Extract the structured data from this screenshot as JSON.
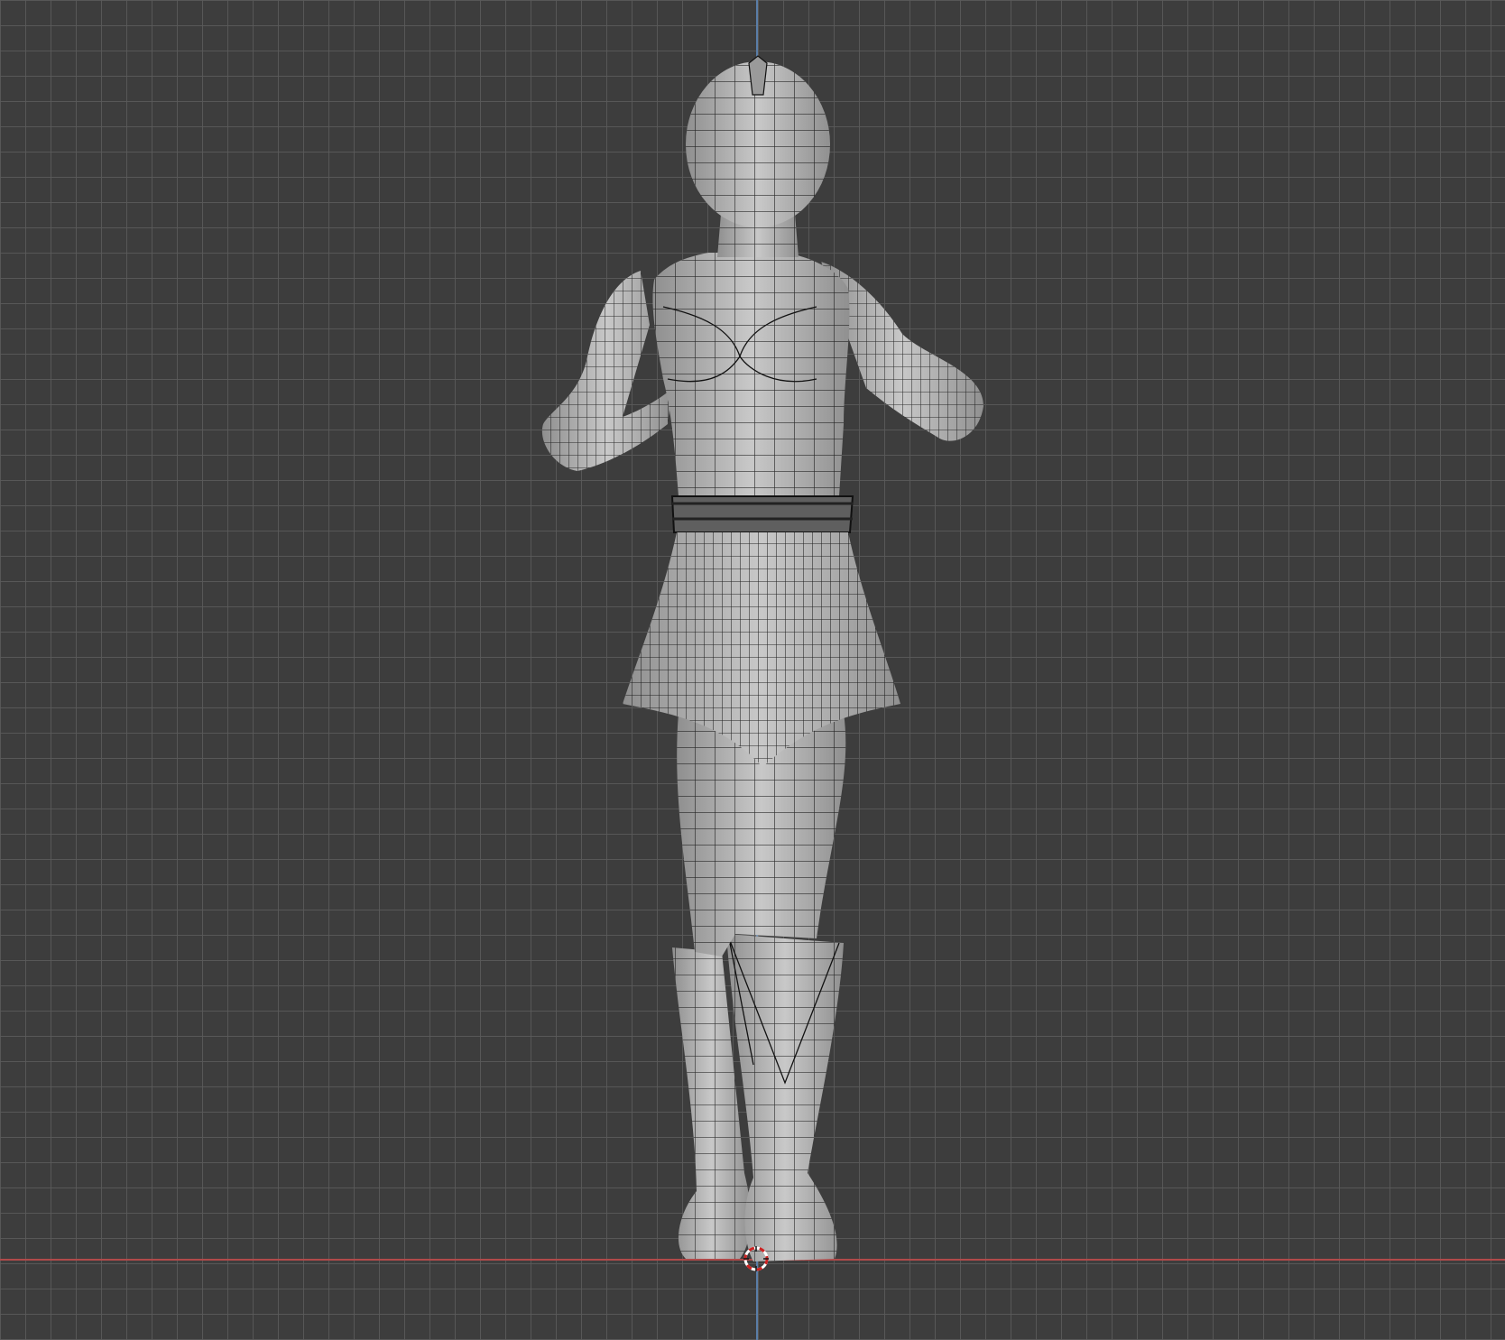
{
  "viewport": {
    "background_color": "#3d3d3d",
    "grid_color": "#5a5a5a",
    "z_axis_color": "#5a7ea8",
    "x_axis_color": "#b04a4a"
  },
  "model": {
    "shading": "solid-wireframe",
    "mesh_color": "#b9b9b9",
    "wire_color": "#111111",
    "subject": "character-back-view"
  },
  "cursor_3d": {
    "icon": "3d-cursor-icon",
    "ring_color_a": "#ffffff",
    "ring_color_b": "#cc2222"
  }
}
